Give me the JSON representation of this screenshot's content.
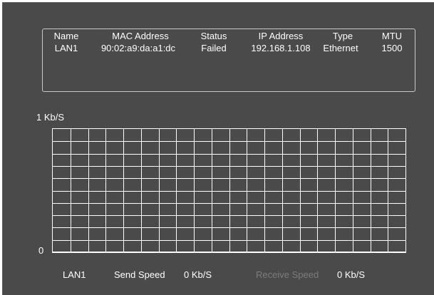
{
  "network_table": {
    "headers": [
      "Name",
      "MAC Address",
      "Status",
      "IP Address",
      "Type",
      "MTU"
    ],
    "rows": [
      [
        "LAN1",
        "90:02:a9:da:a1:dc",
        "Failed",
        "192.168.1.108",
        "Ethernet",
        "1500"
      ]
    ]
  },
  "chart_data": {
    "type": "line",
    "ylim": [
      "0",
      "1 Kb/S"
    ],
    "y_top_label": "1 Kb/S",
    "y_bottom_label": "0",
    "grid": true,
    "series": [
      {
        "name": "Send Speed",
        "values": [
          0
        ]
      },
      {
        "name": "Receive Speed",
        "values": [
          0
        ]
      }
    ]
  },
  "speed_footer": {
    "interface": "LAN1",
    "send_label": "Send Speed",
    "send_value": "0 Kb/S",
    "receive_label": "Receive Speed",
    "receive_value": "0 Kb/S"
  },
  "colors": {
    "panel_background": "#4a4a4a",
    "text": "#ffffff",
    "dim_text": "#7c7c7c"
  }
}
